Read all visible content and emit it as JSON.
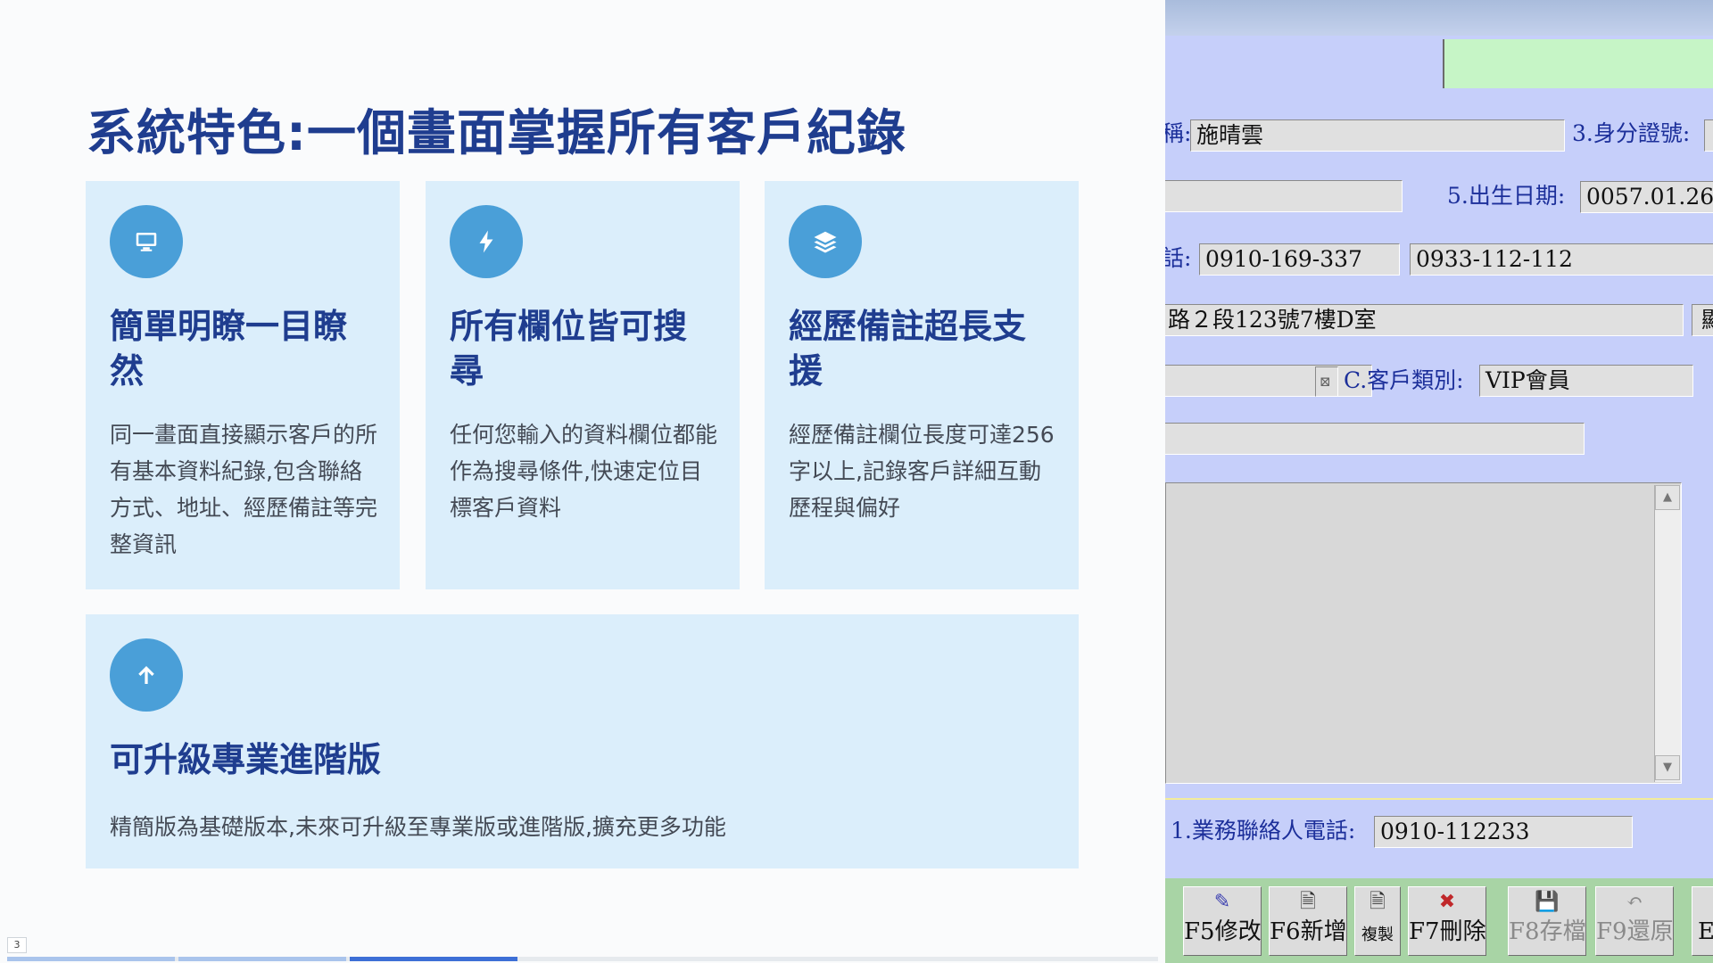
{
  "slide": {
    "title": "系統特色:一個畫面掌握所有客戶紀錄",
    "page_number": "3",
    "colors": {
      "accent": "#1f3d8f",
      "card_bg": "#dbeefb",
      "icon_bg": "#4a9fd8"
    },
    "cards": [
      {
        "icon": "monitor-icon",
        "title": "簡單明瞭一目瞭然",
        "desc": "同一畫面直接顯示客戶的所有基本資料紀錄,包含聯絡方式、地址、經歷備註等完整資訊"
      },
      {
        "icon": "lightning-icon",
        "title": "所有欄位皆可搜尋",
        "desc": "任何您輸入的資料欄位都能作為搜尋條件,快速定位目標客戶資料"
      },
      {
        "icon": "layers-icon",
        "title": "經歷備註超長支援",
        "desc": "經歷備註欄位長度可達256字以上,記錄客戶詳細互動歷程與偏好"
      },
      {
        "icon": "arrow-up-icon",
        "title": "可升級專業進階版",
        "desc": "精簡版為基礎版本,未來可升級至專業版或進階版,擴充更多功能"
      }
    ]
  },
  "app": {
    "labels": {
      "name": "稱:",
      "id_number": "3.身分證號:",
      "birth_date": "5.出生日期:",
      "phone": "話:",
      "customer_type": "C.客戶類別:",
      "contact_phone": "1.業務聯絡人電話:"
    },
    "fields": {
      "name": "施晴雲",
      "id_number": "",
      "birth_date": "0057.01.26",
      "phone1": "0910-169-337",
      "phone2": "0933-112-112",
      "address": "路２段123號7樓D室",
      "address_btn": "顯",
      "customer_type": "VIP會員",
      "contact_phone": "0910-112233"
    },
    "toolbar": [
      {
        "icon": "edit-icon",
        "label": "F5修改",
        "enabled": true
      },
      {
        "icon": "new-doc-icon",
        "label": "F6新增",
        "enabled": true
      },
      {
        "icon": "copy-icon",
        "label": "複製",
        "enabled": true
      },
      {
        "icon": "delete-icon",
        "label": "F7刪除",
        "enabled": true
      },
      {
        "icon": "save-icon",
        "label": "F8存檔",
        "enabled": false
      },
      {
        "icon": "undo-icon",
        "label": "F9還原",
        "enabled": false
      },
      {
        "icon": "exit-icon",
        "label": "E",
        "enabled": true
      }
    ]
  }
}
